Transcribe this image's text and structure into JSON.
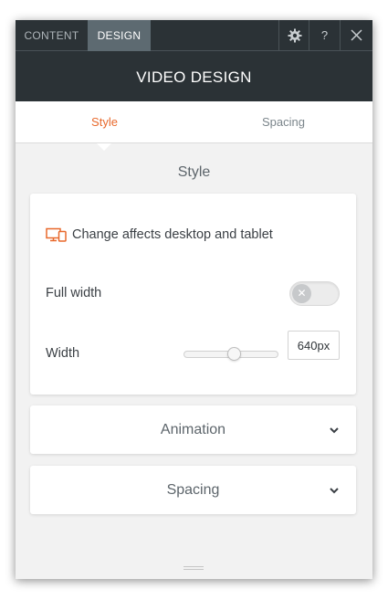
{
  "topbar": {
    "tabs": [
      {
        "label": "CONTENT"
      },
      {
        "label": "DESIGN"
      }
    ],
    "icons": {
      "settings": "gear-icon",
      "help": "?",
      "close": "close-icon"
    }
  },
  "header": {
    "title": "VIDEO DESIGN"
  },
  "subtabs": [
    {
      "label": "Style",
      "active": true
    },
    {
      "label": "Spacing",
      "active": false
    }
  ],
  "section": {
    "title": "Style"
  },
  "style_card": {
    "notice": "Change affects desktop and tablet",
    "full_width_label": "Full width",
    "full_width_on": false,
    "width_label": "Width",
    "width_value": "640px",
    "width_slider_fraction": 0.53
  },
  "accordions": [
    {
      "label": "Animation"
    },
    {
      "label": "Spacing"
    }
  ],
  "colors": {
    "accent": "#e8692c",
    "dark_header": "#2b3236",
    "active_tab": "#5d6a71"
  }
}
